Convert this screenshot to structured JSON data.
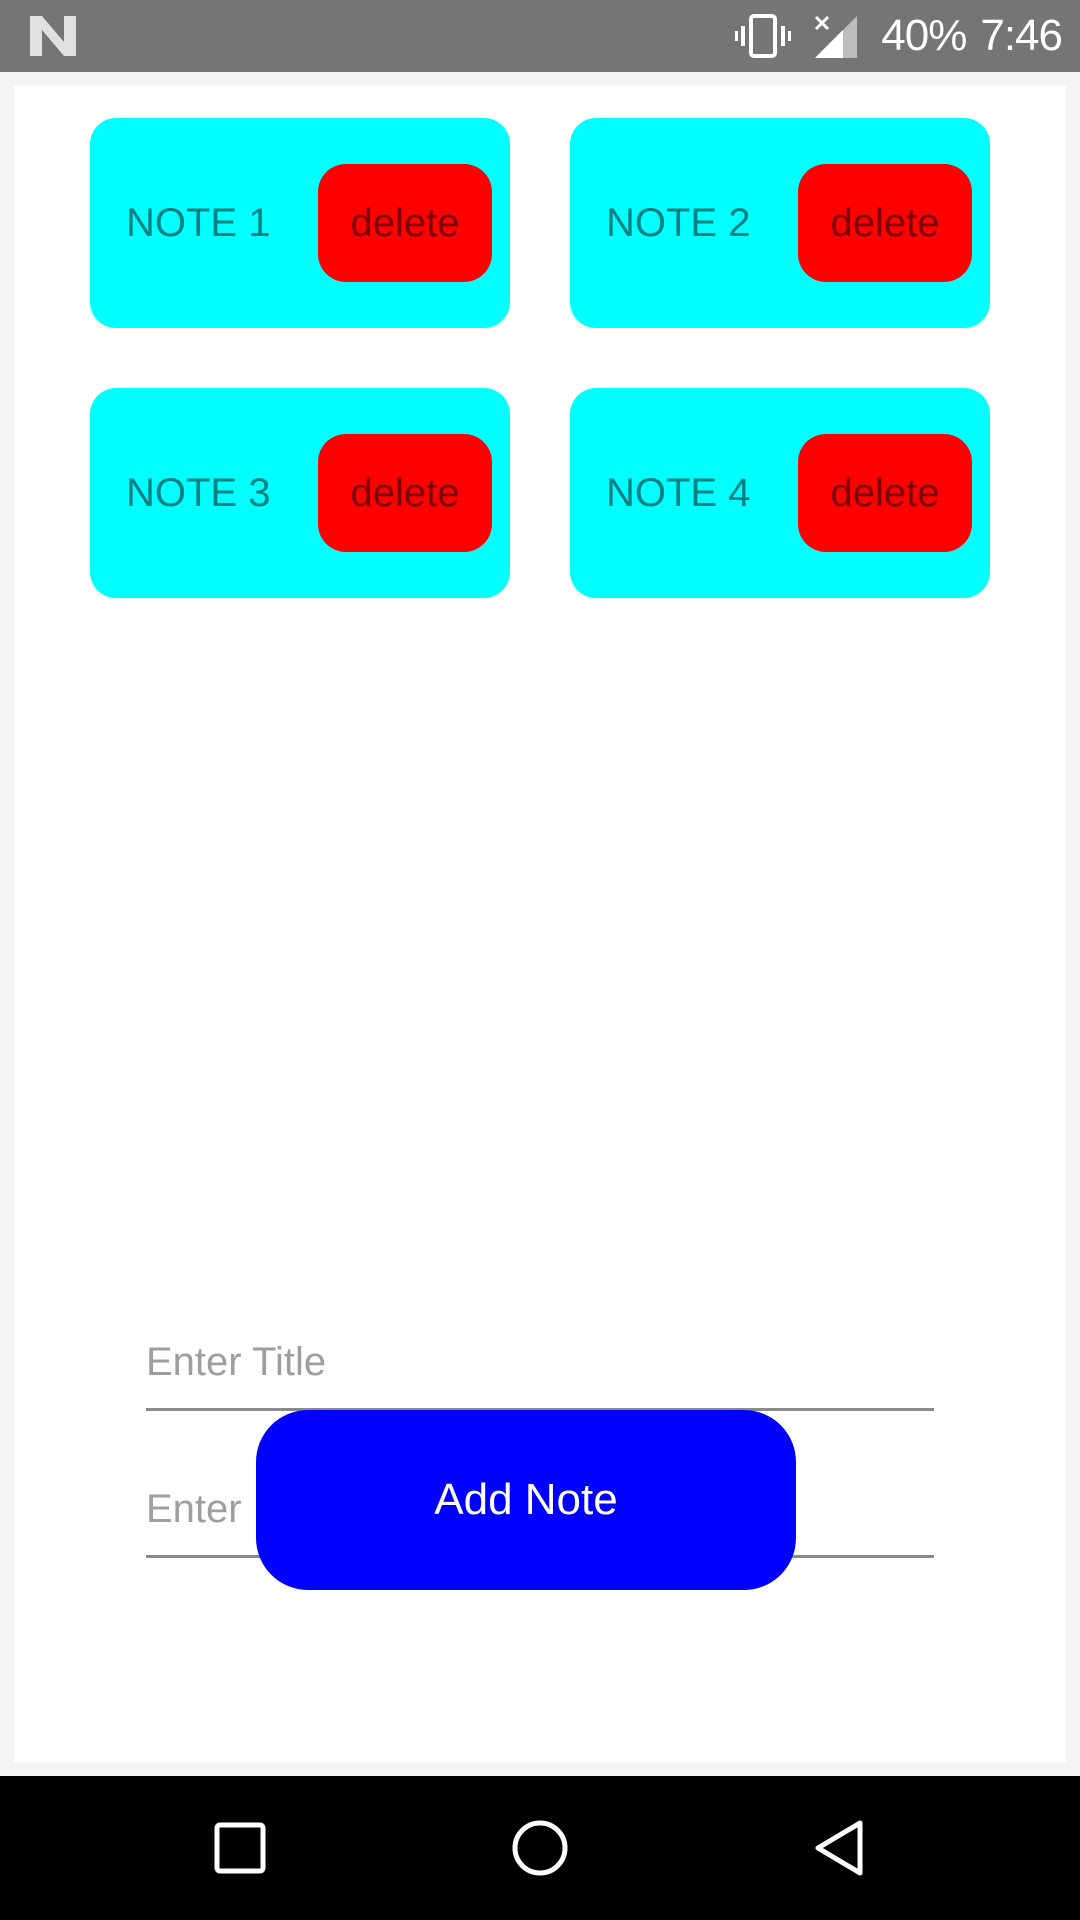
{
  "status_bar": {
    "battery": "40%",
    "time": "7:46",
    "icons": [
      "notification-n-icon",
      "vibrate-icon",
      "no-signal-icon"
    ]
  },
  "notes": [
    {
      "title": "NOTE 1",
      "delete_label": "delete"
    },
    {
      "title": "NOTE 2",
      "delete_label": "delete"
    },
    {
      "title": "NOTE 3",
      "delete_label": "delete"
    },
    {
      "title": "NOTE 4",
      "delete_label": "delete"
    }
  ],
  "form": {
    "title_value": "",
    "title_placeholder": "Enter Title",
    "description_value": "",
    "description_placeholder": "Enter Description",
    "add_label": "Add Note"
  },
  "nav_bar": {
    "buttons": [
      "recents-icon",
      "home-icon",
      "back-icon"
    ]
  },
  "colors": {
    "status_bar": "#757575",
    "note_card": "#00ffff",
    "delete_button": "#ff0000",
    "add_button": "#0000ff",
    "nav_bar": "#000000"
  }
}
